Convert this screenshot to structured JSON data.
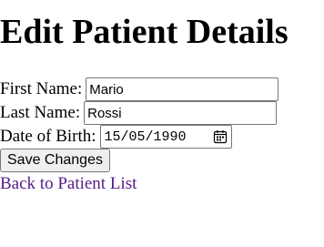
{
  "page": {
    "title": "Edit Patient Details"
  },
  "form": {
    "first_name": {
      "label": "First Name:",
      "value": "Mario"
    },
    "last_name": {
      "label": "Last Name:",
      "value": "Rossi"
    },
    "date_of_birth": {
      "label": "Date of Birth:",
      "value": "15/05/1990",
      "icon": "calendar-icon"
    },
    "save_label": "Save Changes"
  },
  "links": {
    "back_label": "Back to Patient List",
    "visited_color": "#551a8b"
  }
}
